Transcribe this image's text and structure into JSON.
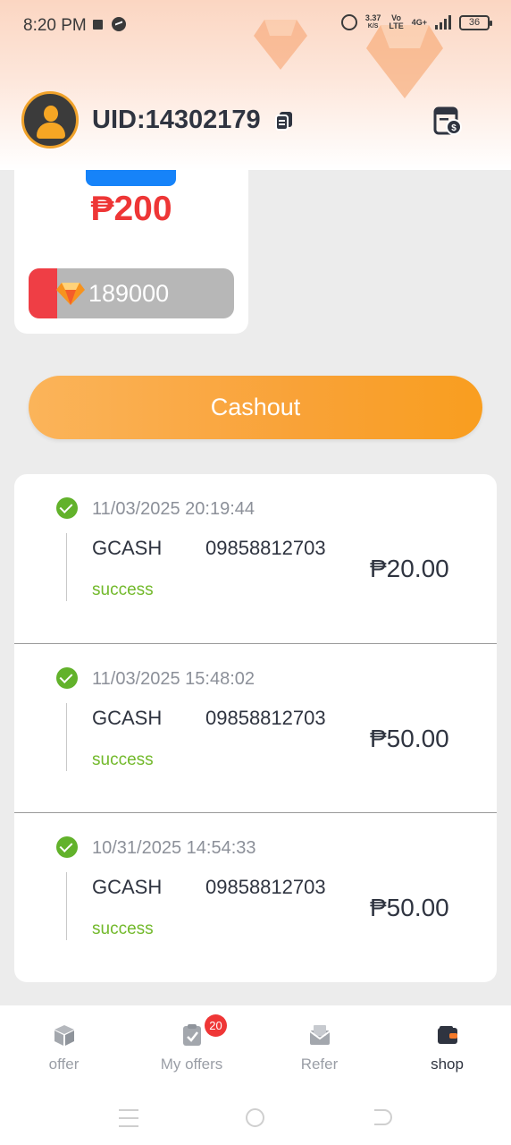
{
  "status_bar": {
    "time": "8:20 PM",
    "net_speed_value": "3.37",
    "net_speed_unit": "K/S",
    "volte_top": "Vo",
    "volte_bottom": "LTE",
    "network": "4G+",
    "battery": "36"
  },
  "header": {
    "uid": "UID:14302179",
    "icons": [
      "avatar",
      "copy-icon",
      "wallet-icon"
    ],
    "gradient_top": "#fbd6c2"
  },
  "card": {
    "amount": "₱200",
    "progress_value": "189000",
    "progress_fraction": 0.14,
    "accent_color": "#ee3636",
    "tab_color": "#1683f9"
  },
  "cashout_label": "Cashout",
  "records": [
    {
      "datetime": "11/03/2025 20:19:44",
      "method": "GCASH",
      "account": "09858812703",
      "status": "success",
      "amount": "₱20.00"
    },
    {
      "datetime": "11/03/2025 15:48:02",
      "method": "GCASH",
      "account": "09858812703",
      "status": "success",
      "amount": "₱50.00"
    },
    {
      "datetime": "10/31/2025 14:54:33",
      "method": "GCASH",
      "account": "09858812703",
      "status": "success",
      "amount": "₱50.00"
    }
  ],
  "bottom_nav": {
    "items": [
      {
        "label": "offer",
        "icon": "box-icon"
      },
      {
        "label": "My offers",
        "icon": "clipboard-check-icon",
        "badge": "20"
      },
      {
        "label": "Refer",
        "icon": "envelope-icon"
      },
      {
        "label": "shop",
        "icon": "wallet-icon",
        "active": true
      }
    ]
  },
  "colors": {
    "success": "#72b92b",
    "cashout_orange": "#f9a237",
    "text_dark": "#2f3440"
  }
}
